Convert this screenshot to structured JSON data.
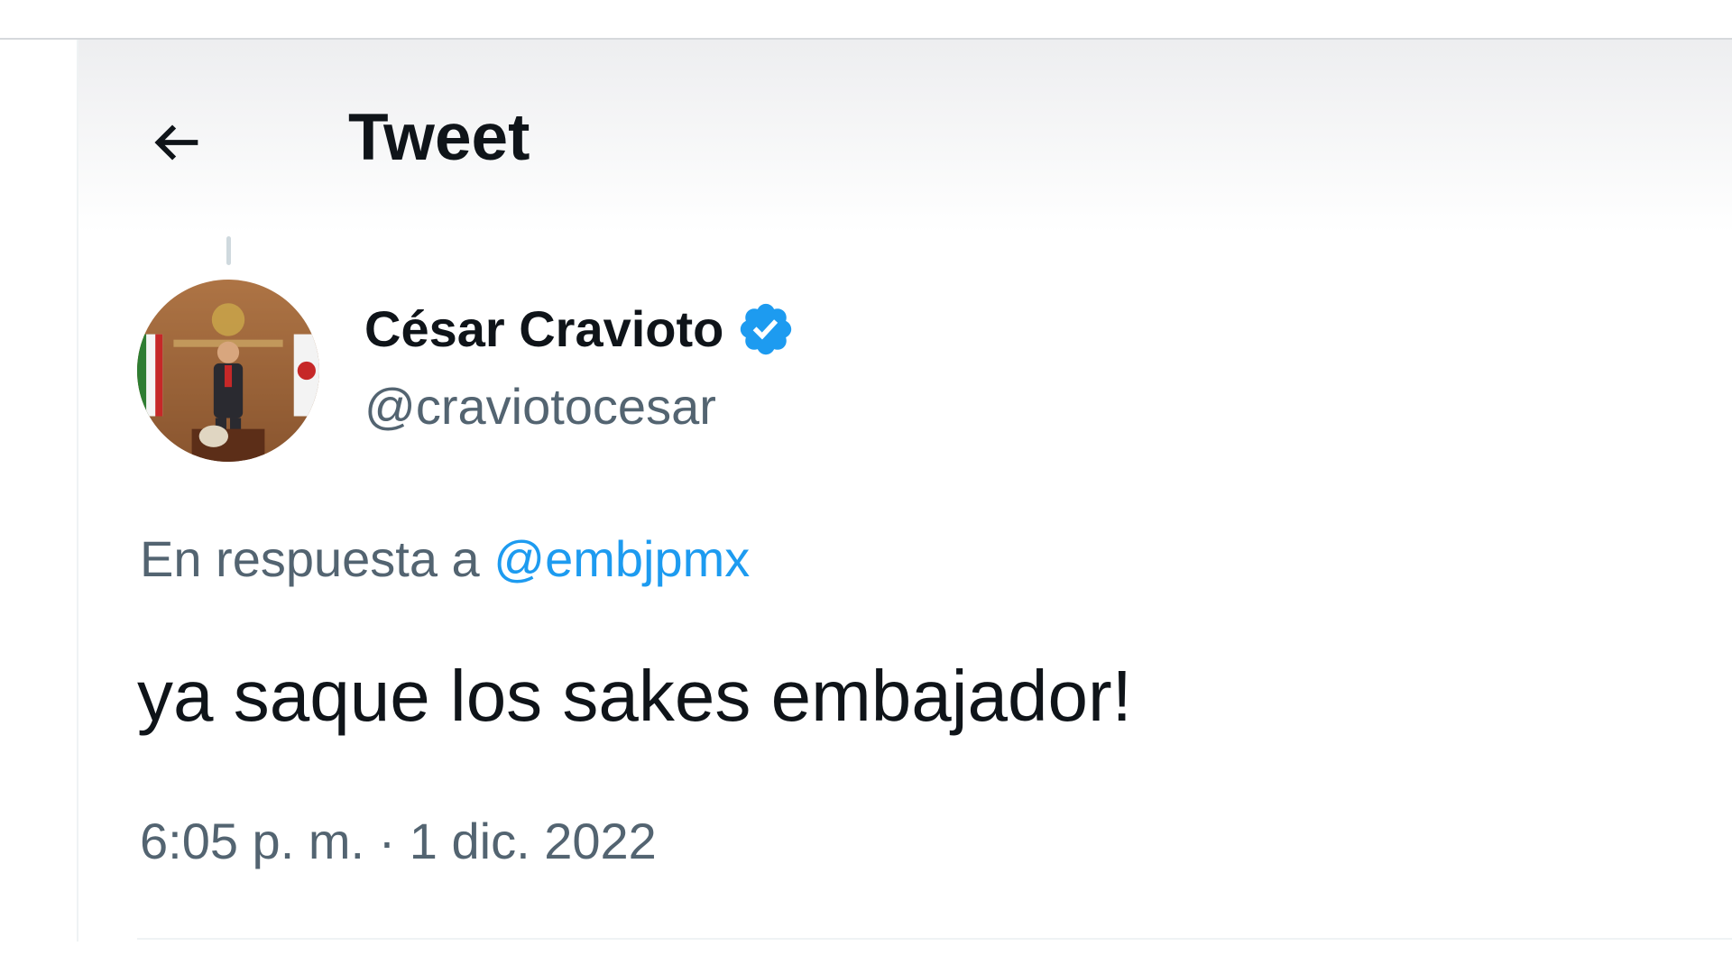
{
  "header": {
    "title": "Tweet",
    "back_icon": "arrow-left-icon"
  },
  "tweet": {
    "author": {
      "name": "César Cravioto",
      "handle": "@craviotocesar",
      "verified": true,
      "verified_color": "#1d9bf0"
    },
    "reply": {
      "prefix": "En respuesta a",
      "to_handle": "@embjpmx"
    },
    "text": "ya saque los sakes embajador!",
    "timestamp": "6:05 p. m. · 1 dic. 2022"
  },
  "colors": {
    "primary_text": "#0f1419",
    "secondary_text": "#536471",
    "accent": "#1d9bf0"
  }
}
